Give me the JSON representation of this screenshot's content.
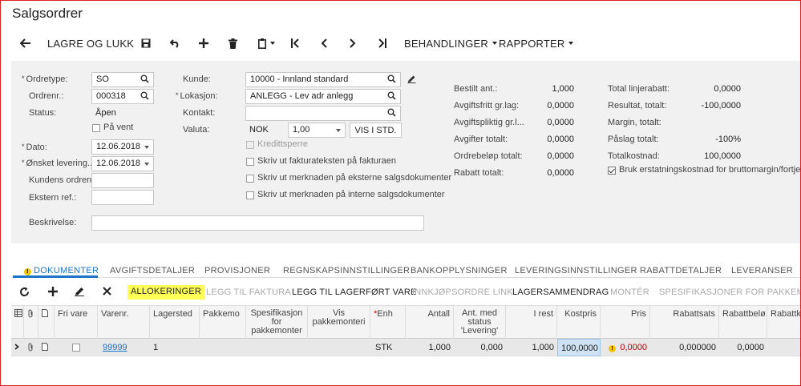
{
  "page_title": "Salgsordrer",
  "toolbar": {
    "save_close": "LAGRE OG LUKK",
    "processes": "BEHANDLINGER",
    "reports": "RAPPORTER"
  },
  "form": {
    "ordertype_label": "Ordretype:",
    "ordertype_value": "SO",
    "ordernr_label": "Ordrenr.:",
    "ordernr_value": "000318",
    "status_label": "Status:",
    "status_value": "Åpen",
    "on_hold_label": "På vent",
    "date_label": "Dato:",
    "date_value": "12.06.2018",
    "requested_label": "Ønsket levering...",
    "requested_value": "12.06.2018",
    "customer_ordernr_label": "Kundens ordrenr.:",
    "external_ref_label": "Ekstern ref.:",
    "description_label": "Beskrivelse:",
    "customer_label": "Kunde:",
    "customer_value": "10000 - Innland standard",
    "location_label": "Lokasjon:",
    "location_value": "ANLEGG - Lev adr anlegg",
    "contact_label": "Kontakt:",
    "currency_label": "Valuta:",
    "currency_code": "NOK",
    "currency_rate": "1,00",
    "view_base_btn": "VIS I STD.",
    "credit_hold_label": "Kredittsperre",
    "print_invoice_label": "Skriv ut fakturateksten på fakturaen",
    "print_external_label": "Skriv ut merknaden på eksterne salgsdokumenter",
    "print_internal_label": "Skriv ut merknaden på interne salgsdokumenter"
  },
  "totals_left": [
    {
      "label": "Bestilt ant.:",
      "value": "1,000"
    },
    {
      "label": "Avgiftsfritt gr.lag:",
      "value": "0,0000"
    },
    {
      "label": "Avgiftspliktig gr.l...",
      "value": "0,0000"
    },
    {
      "label": "Avgifter totalt:",
      "value": "0,0000"
    },
    {
      "label": "Ordrebeløp totalt:",
      "value": "0,0000"
    },
    {
      "label": "Rabatt totalt:",
      "value": "0,0000"
    }
  ],
  "totals_right": [
    {
      "label": "Total linjerabatt:",
      "value": "0,0000"
    },
    {
      "label": "Resultat, totalt:",
      "value": "-100,0000"
    },
    {
      "label": "Margin, totalt:",
      "value": ""
    },
    {
      "label": "Påslag totalt:",
      "value": "-100%"
    },
    {
      "label": "Totalkostnad:",
      "value": "100,0000"
    }
  ],
  "replacement_cost_label": "Bruk erstatningskostnad for bruttomargin/fortjeneste",
  "tabs": [
    "DOKUMENTER",
    "AVGIFTSDETALJER",
    "PROVISJONER",
    "REGNSKAPSINNSTILLINGER",
    "BANKOPPLYSNINGER",
    "LEVERINGSINNSTILLINGER",
    "RABATTDETALJER",
    "LEVERANSER"
  ],
  "grid_toolbar": {
    "allocations": "ALLOKERINGER",
    "add_invoice": "LEGG TIL FAKTURA",
    "add_stock": "LEGG TIL LAGERFØRT VARE",
    "po_link": "INNKJØPSORDRE LINK",
    "inventory_summary": "LAGERSAMMENDRAG",
    "configure": "MONTÉR",
    "kit_specs": "SPESIFIKASJONER FOR PAKKEMONTERI"
  },
  "grid_headers": {
    "free_item": "Fri vare",
    "item_nr": "Varenr.",
    "warehouse": "Lagersted",
    "kit": "Pakkemo",
    "kit_spec": "Spesifikasjon for pakkemonter",
    "show_kit": "Vis pakkemonteri",
    "uom": "Enh",
    "qty": "Antall",
    "qty_status": "Ant. med status 'Levering'",
    "open": "I rest",
    "cost": "Kostpris",
    "price": "Pris",
    "discount_pct": "Rabattsats",
    "discount_amt": "Rabattbelø",
    "discount_code": "Rabattko"
  },
  "grid_row": {
    "item_nr": "99999",
    "warehouse": "1",
    "uom": "STK",
    "qty": "1,000",
    "qty_status": "0,000",
    "open": "1,000",
    "cost": "100,0000",
    "price": "0,0000",
    "discount_pct": "0,000000",
    "discount_amt": "0,0000"
  }
}
